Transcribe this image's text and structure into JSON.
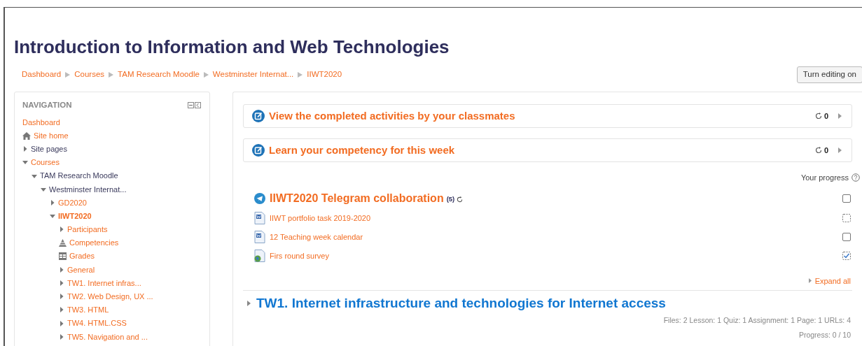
{
  "page_title": "Introduction to Information and Web Technologies",
  "breadcrumb": [
    "Dashboard",
    "Courses",
    "TAM Research Moodle",
    "Westminster Internat...",
    "IIWT2020"
  ],
  "edit_button": "Turn editing on",
  "navigation": {
    "title": "NAVIGATION",
    "items": [
      {
        "label": "Dashboard",
        "kind": "link"
      },
      {
        "label": "Site home",
        "kind": "home"
      },
      {
        "label": "Site pages",
        "kind": "branch",
        "expanded": false
      },
      {
        "label": "Courses",
        "kind": "link-branch",
        "expanded": true,
        "children": [
          {
            "label": "TAM Research Moodle",
            "kind": "branch",
            "expanded": true,
            "children": [
              {
                "label": "Westminster Internat...",
                "kind": "branch",
                "expanded": true,
                "children": [
                  {
                    "label": "GD2020",
                    "kind": "link-branch",
                    "expanded": false
                  },
                  {
                    "label": "IIWT2020",
                    "kind": "link-branch",
                    "expanded": true,
                    "current": true,
                    "children": [
                      {
                        "label": "Participants",
                        "kind": "link-branch",
                        "expanded": false
                      },
                      {
                        "label": "Competencies",
                        "kind": "competencies"
                      },
                      {
                        "label": "Grades",
                        "kind": "grades"
                      },
                      {
                        "label": "General",
                        "kind": "link-branch",
                        "expanded": false
                      },
                      {
                        "label": "TW1. Internet infras...",
                        "kind": "link-branch",
                        "expanded": false
                      },
                      {
                        "label": "TW2. Web Design, UX ...",
                        "kind": "link-branch",
                        "expanded": false
                      },
                      {
                        "label": "TW3. HTML",
                        "kind": "link-branch",
                        "expanded": false
                      },
                      {
                        "label": "TW4. HTML.CSS",
                        "kind": "link-branch",
                        "expanded": false
                      },
                      {
                        "label": "TW5. Navigation and ...",
                        "kind": "link-branch",
                        "expanded": false
                      }
                    ]
                  }
                ]
              }
            ]
          }
        ]
      }
    ]
  },
  "featured": [
    {
      "title": "View the completed activities by your classmates",
      "count": "0"
    },
    {
      "title": "Learn your competency for this week",
      "count": "0"
    }
  ],
  "progress_label": "Your progress",
  "activities": [
    {
      "kind": "telegram",
      "title": "IIWT2020 Telegram collaboration",
      "count": "(5)",
      "automatic": false,
      "checked": false
    },
    {
      "kind": "document",
      "title": "IIWT portfolio task 2019-2020",
      "automatic": true,
      "checked": false
    },
    {
      "kind": "document",
      "title": "12 Teaching week calendar",
      "automatic": false,
      "checked": false
    },
    {
      "kind": "survey",
      "title": "Firs round survey",
      "automatic": true,
      "checked": true
    }
  ],
  "expand_all": "Expand all",
  "section": {
    "title": "TW1. Internet infrastructure and technologies for Internet access",
    "expanded": false,
    "summary": "Files: 2 Lesson: 1 Quiz: 1 Assignment: 1 Page: 1 URLs: 4",
    "progress": "Progress: 0 / 10"
  }
}
